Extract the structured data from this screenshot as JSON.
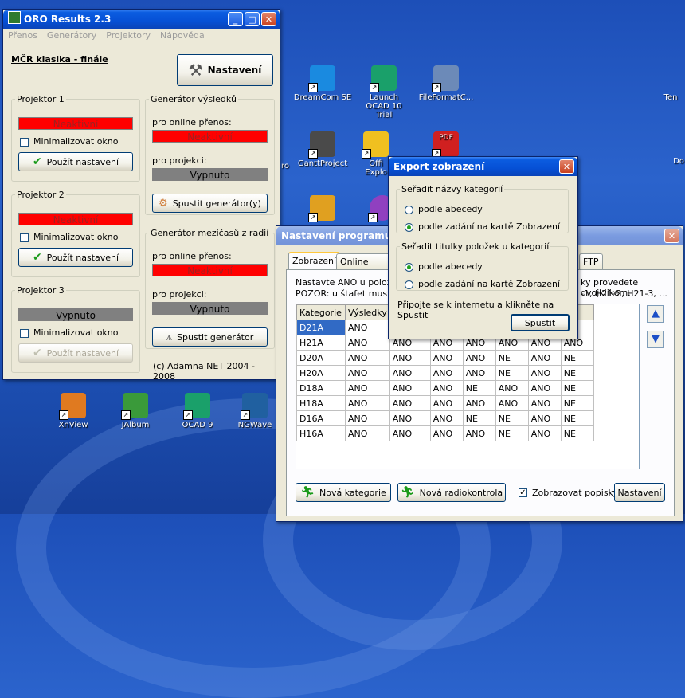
{
  "desktop": {
    "icons": [
      {
        "label": "DreamCom SE",
        "color": "#1a8ae0"
      },
      {
        "label": "Launch OCAD 10 Trial",
        "color": "#1aa06a"
      },
      {
        "label": "FileFormatC...",
        "color": "#6c8ab8"
      },
      {
        "label": "Ten",
        "color": "#3060c0"
      },
      {
        "label": "GanttProject",
        "color": "#4a4a4a"
      },
      {
        "label": "Offi Explo",
        "color": "#f0c020"
      },
      {
        "label": "PDF",
        "color": "#d02020"
      },
      {
        "label": "Do",
        "color": "#e09020"
      },
      {
        "label": "ro",
        "color": "#3060c0"
      },
      {
        "label": "XnView",
        "color": "#e07a20"
      },
      {
        "label": "JAlbum",
        "color": "#3a9a3a"
      },
      {
        "label": "OCAD 9",
        "color": "#1aa06a"
      },
      {
        "label": "NGWave",
        "color": "#2060a0"
      }
    ]
  },
  "oro": {
    "title": "ORO Results 2.3",
    "menu": [
      "Přenos",
      "Generátory",
      "Projektory",
      "Nápověda"
    ],
    "event_title": "MČR klasika - finále",
    "settings_button": "Nastavení",
    "projectors": [
      {
        "legend": "Projektor 1",
        "status": "Neaktivní",
        "status_color": "red",
        "minimize_label": "Minimalizovat okno",
        "apply_label": "Použít nastavení",
        "apply_enabled": true
      },
      {
        "legend": "Projektor 2",
        "status": "Neaktivní",
        "status_color": "red",
        "minimize_label": "Minimalizovat okno",
        "apply_label": "Použít nastavení",
        "apply_enabled": true
      },
      {
        "legend": "Projektor 3",
        "status": "Vypnuto",
        "status_color": "gray",
        "minimize_label": "Minimalizovat okno",
        "apply_label": "Použít nastavení",
        "apply_enabled": false
      }
    ],
    "gen_results": {
      "legend": "Generátor výsledků",
      "online_label": "pro online přenos:",
      "online_status": "Neaktivní",
      "projection_label": "pro projekci:",
      "projection_status": "Vypnuto",
      "start_button": "Spustit generátor(y)"
    },
    "gen_splits": {
      "legend": "Generátor mezičasů z radií",
      "online_label": "pro online přenos:",
      "online_status": "Neaktivní",
      "projection_label": "pro projekci:",
      "projection_status": "Vypnuto",
      "start_button": "Spustit generátor"
    },
    "copyright": "(c) Adamna NET 2004 - 2008"
  },
  "nastaveni": {
    "title": "Nastavení programu",
    "tabs": [
      "Zobrazení",
      "Online výsled",
      "FTP"
    ],
    "info_line1": "Nastavte ANO u položek",
    "info_line1_right": "ky provedete dvojklikem.",
    "info_line2": "POZOR: u štafet musíte",
    "info_line2_right": "-1, H21-2, H21-3, ...",
    "columns": [
      "Kategorie",
      "Výsledky",
      "",
      "",
      "",
      "",
      "",
      ""
    ],
    "rows": [
      [
        "D21A",
        "ANO",
        "A",
        "",
        "",
        "",
        "",
        ""
      ],
      [
        "H21A",
        "ANO",
        "ANO",
        "ANO",
        "ANO",
        "ANO",
        "ANO",
        "ANO"
      ],
      [
        "D20A",
        "ANO",
        "ANO",
        "ANO",
        "ANO",
        "NE",
        "ANO",
        "NE"
      ],
      [
        "H20A",
        "ANO",
        "ANO",
        "ANO",
        "ANO",
        "NE",
        "ANO",
        "NE"
      ],
      [
        "D18A",
        "ANO",
        "ANO",
        "ANO",
        "NE",
        "ANO",
        "ANO",
        "NE"
      ],
      [
        "H18A",
        "ANO",
        "ANO",
        "ANO",
        "ANO",
        "ANO",
        "ANO",
        "NE"
      ],
      [
        "D16A",
        "ANO",
        "ANO",
        "ANO",
        "NE",
        "NE",
        "ANO",
        "NE"
      ],
      [
        "H16A",
        "ANO",
        "ANO",
        "ANO",
        "ANO",
        "NE",
        "ANO",
        "NE"
      ]
    ],
    "new_category_button": "Nová kategorie",
    "new_radio_button": "Nová radiokontrola",
    "show_labels_label": "Zobrazovat popisky",
    "show_labels_checked": true,
    "settings_button": "Nastavení"
  },
  "export": {
    "title": "Export zobrazení",
    "group1_legend": "Seřadit názvy kategorií",
    "group1_options": [
      "podle abecedy",
      "podle zadání na kartě Zobrazení"
    ],
    "group1_selected": 1,
    "group2_legend": "Seřadit titulky položek u kategorií",
    "group2_options": [
      "podle abecedy",
      "podle zadání na kartě Zobrazení"
    ],
    "group2_selected": 0,
    "hint": "Připojte se k internetu a klikněte na Spustit",
    "run_button": "Spustit"
  }
}
